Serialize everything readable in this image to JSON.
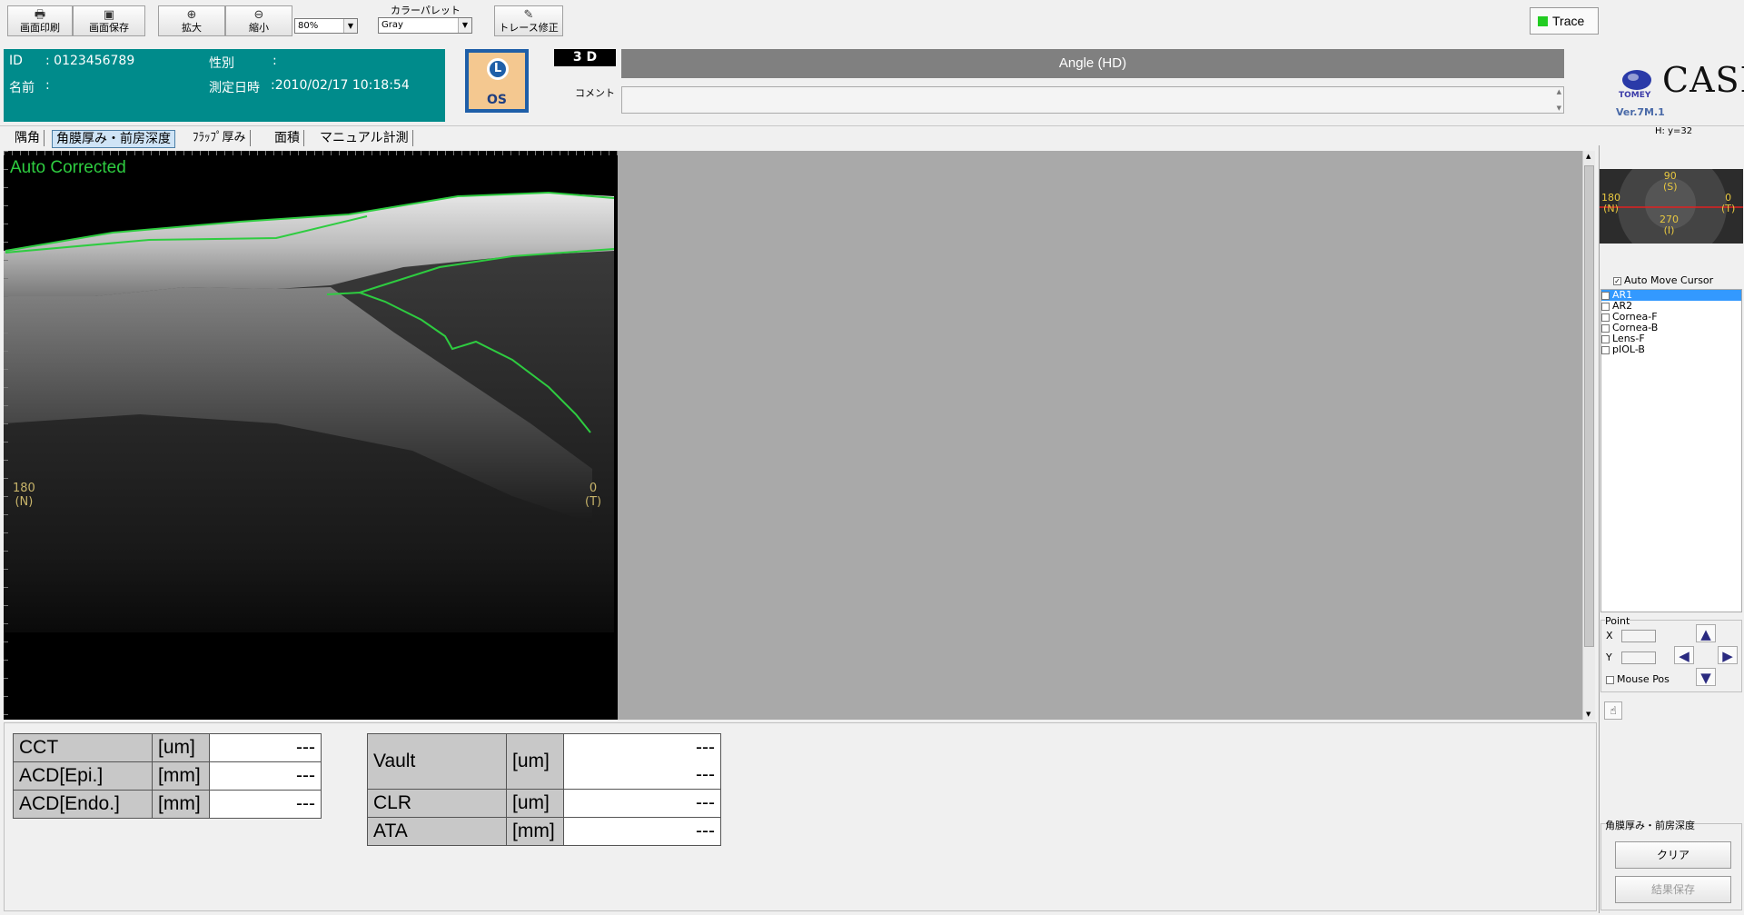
{
  "toolbar": {
    "print_label": "画面印刷",
    "save_label": "画面保存",
    "zoom_in_label": "拡大",
    "zoom_out_label": "縮小",
    "zoom_value": "80%",
    "palette_title": "カラーパレット",
    "palette_value": "Gray",
    "trace_edit_label": "トレース修正",
    "trace_label": "Trace",
    "trace_color": "#22cc22"
  },
  "patient": {
    "id_label": "ID",
    "id_value": ": 0123456789",
    "sex_label": "性別",
    "sex_value": ":",
    "name_label": "名前",
    "name_value": ":",
    "date_label": "測定日時",
    "date_value": ":2010/02/17 10:18:54"
  },
  "eye": {
    "top": "L",
    "bottom": "OS"
  },
  "scan": {
    "mode": "3 D",
    "title": "Angle (HD)",
    "comment_label": "コメント",
    "comment_value": ""
  },
  "brand": {
    "logo_text": "CASIA",
    "company": "TOMEY",
    "version": "Ver.7M.1"
  },
  "cursor_readout": "H: y=32",
  "tabs": [
    {
      "label": "隅角",
      "selected": false
    },
    {
      "label": "角膜厚み・前房深度",
      "selected": true
    },
    {
      "label": "ﾌﾗｯﾌﾟ厚み",
      "selected": false
    },
    {
      "label": "面積",
      "selected": false
    },
    {
      "label": "マニュアル計測",
      "selected": false
    }
  ],
  "image": {
    "status": "Auto Corrected",
    "left_angle": "180",
    "left_dir": "(N)",
    "right_angle": "0",
    "right_dir": "(T)"
  },
  "thumb": {
    "top_angle": "90",
    "top_dir": "(S)",
    "left_angle": "180",
    "left_dir": "(N)",
    "right_angle": "0",
    "right_dir": "(T)",
    "bottom_angle": "270",
    "bottom_dir": "(I)"
  },
  "layers": {
    "auto_move_label": "Auto Move Cursor",
    "auto_move_checked": true,
    "items": [
      {
        "label": "AR1",
        "checked": false,
        "selected": true
      },
      {
        "label": "AR2",
        "checked": false,
        "selected": false
      },
      {
        "label": "Cornea-F",
        "checked": false,
        "selected": false
      },
      {
        "label": "Cornea-B",
        "checked": false,
        "selected": false
      },
      {
        "label": "Lens-F",
        "checked": false,
        "selected": false
      },
      {
        "label": "pIOL-B",
        "checked": false,
        "selected": false
      }
    ]
  },
  "point": {
    "group_label": "Point",
    "x_label": "X",
    "y_label": "Y",
    "x_value": "",
    "y_value": "",
    "mouse_pos_label": "Mouse Pos",
    "mouse_pos_checked": false
  },
  "result": {
    "group_label": "角膜厚み・前房深度",
    "clear_label": "クリア",
    "save_label": "結果保存"
  },
  "measurements_left": [
    {
      "label": "CCT",
      "unit": "[um]",
      "value": "---"
    },
    {
      "label": "ACD[Epi.]",
      "unit": "[mm]",
      "value": "---"
    },
    {
      "label": "ACD[Endo.]",
      "unit": "[mm]",
      "value": "---"
    }
  ],
  "measurements_right": {
    "vault": {
      "label": "Vault",
      "unit": "[um]",
      "value1": "---",
      "value2": "---"
    },
    "rows": [
      {
        "label": "CLR",
        "unit": "[um]",
        "value": "---"
      },
      {
        "label": "ATA",
        "unit": "[mm]",
        "value": "---"
      }
    ]
  }
}
